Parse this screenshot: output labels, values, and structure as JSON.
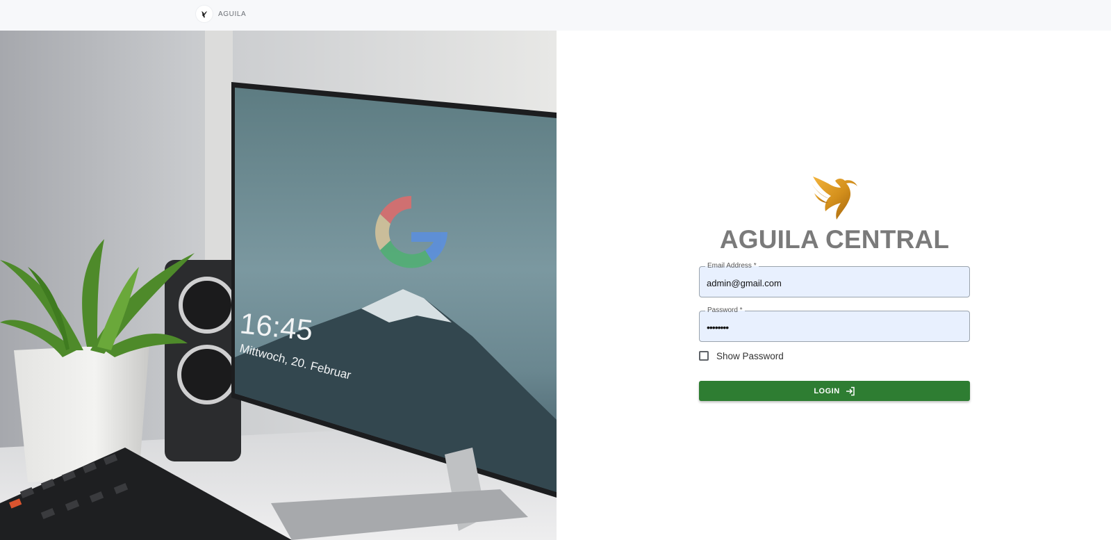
{
  "topbar": {
    "brand": "AGUILA"
  },
  "hero": {
    "clock": "16:45",
    "date": "Mittwoch, 20. Februar"
  },
  "login": {
    "title": "AGUILA CENTRAL",
    "email_label": "Email Address *",
    "email_value": "admin@gmail.com",
    "password_label": "Password *",
    "password_value": "••••••••",
    "show_password_label": "Show Password",
    "show_password_checked": false,
    "button_label": "LOGIN"
  },
  "colors": {
    "accent": "#2e7d32",
    "logo_gold": "#d4901c",
    "input_bg": "#e8f0fe",
    "title_gray": "#7a7a7a"
  },
  "icons": {
    "brand": "eagle-icon",
    "logo": "eagle-logo",
    "login_button": "login-arrow-icon"
  }
}
